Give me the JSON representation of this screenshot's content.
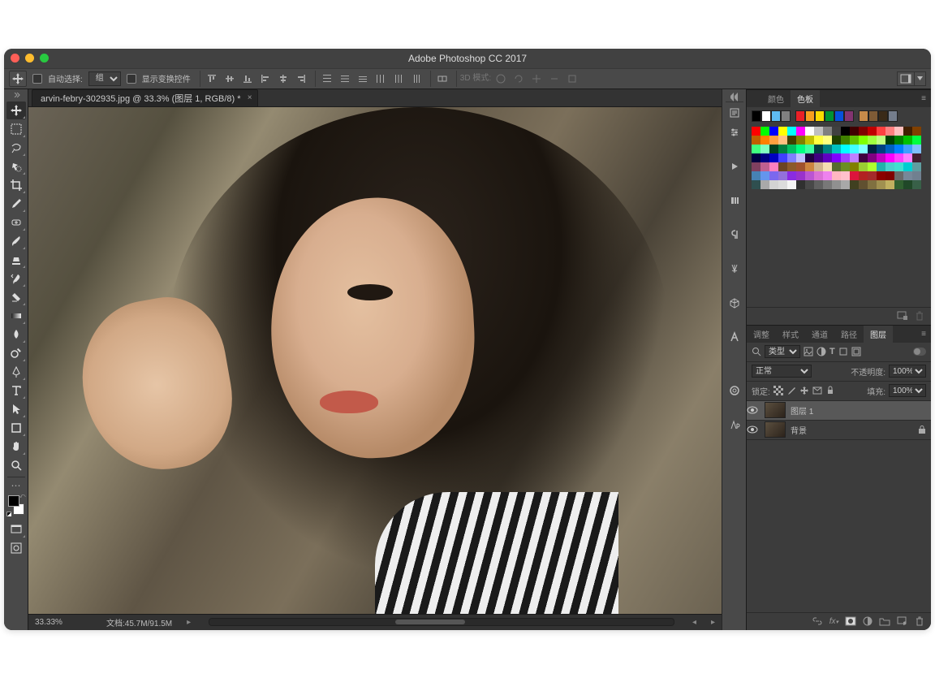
{
  "title": "Adobe Photoshop CC 2017",
  "options": {
    "auto_select": "自动选择:",
    "select_mode": "组",
    "show_transform": "显示变换控件",
    "mode_3d": "3D 模式:"
  },
  "doc_tab": "arvin-febry-302935.jpg @ 33.3% (图层 1, RGB/8) *",
  "status": {
    "zoom": "33.33%",
    "docinfo": "文档:45.7M/91.5M"
  },
  "panel_color_tabs": {
    "t0": "颜色",
    "t1": "色板"
  },
  "panel_layer_tabs": {
    "t0": "调整",
    "t1": "样式",
    "t2": "通道",
    "t3": "路径",
    "t4": "图层"
  },
  "layers": {
    "kind_label": "类型",
    "blend": "正常",
    "opacity_label": "不透明度:",
    "opacity_val": "100%",
    "lock_label": "锁定:",
    "fill_label": "填充:",
    "fill_val": "100%",
    "l0": "图层 1",
    "l1": "背景"
  },
  "palette_row": [
    "#000000",
    "#ffffff",
    "#5ebaf0",
    "#808080",
    "",
    "#ea2027",
    "#f79f1f",
    "#fcdc00",
    "#009432",
    "#0652dd",
    "#833471",
    "",
    "#c78b4a",
    "#7e5b36",
    "#3a2a18",
    "#747d8c"
  ],
  "swatches": [
    "#ff0000",
    "#00ff00",
    "#0000ff",
    "#ffff00",
    "#00ffff",
    "#ff00ff",
    "#ffffff",
    "#c0c0c0",
    "#808080",
    "#404040",
    "#000000",
    "#400000",
    "#800000",
    "#c00000",
    "#ff4040",
    "#ff8080",
    "#ffc0c0",
    "#402000",
    "#804000",
    "#c06000",
    "#ff8000",
    "#ffa040",
    "#ffc080",
    "#404000",
    "#808000",
    "#c0c000",
    "#ffff40",
    "#ffff80",
    "#204000",
    "#408000",
    "#60c000",
    "#80ff00",
    "#a0ff40",
    "#c0ff80",
    "#004000",
    "#008000",
    "#00c000",
    "#00ff40",
    "#40ff80",
    "#80ffc0",
    "#004020",
    "#008040",
    "#00c060",
    "#00ff80",
    "#40ffa0",
    "#004040",
    "#008080",
    "#00c0c0",
    "#00ffff",
    "#40ffff",
    "#80ffff",
    "#002040",
    "#004080",
    "#0060c0",
    "#0080ff",
    "#40a0ff",
    "#80c0ff",
    "#000040",
    "#000080",
    "#0000c0",
    "#4040ff",
    "#8080ff",
    "#c0c0ff",
    "#200040",
    "#400080",
    "#6000c0",
    "#8000ff",
    "#a040ff",
    "#c080ff",
    "#400040",
    "#800080",
    "#c000c0",
    "#ff00ff",
    "#ff40ff",
    "#ff80ff",
    "#402030",
    "#804060",
    "#c06090",
    "#ff80c0",
    "#6b4423",
    "#8b5a2b",
    "#a0522d",
    "#cd853f",
    "#d2b48c",
    "#f5deb3",
    "#556b2f",
    "#6b8e23",
    "#808000",
    "#9acd32",
    "#adff2f",
    "#20b2aa",
    "#48d1cc",
    "#40e0d0",
    "#00ced1",
    "#5f9ea0",
    "#4682b4",
    "#6495ed",
    "#7b68ee",
    "#9370db",
    "#8a2be2",
    "#9932cc",
    "#ba55d3",
    "#da70d6",
    "#ee82ee",
    "#ffb6c1",
    "#ffc0cb",
    "#dc143c",
    "#b22222",
    "#a52a2a",
    "#8b0000",
    "#800000",
    "#696969",
    "#778899",
    "#708090",
    "#2f4f4f",
    "#a9a9a9",
    "#d3d3d3",
    "#dcdcdc",
    "#f5f5f5",
    "#303030",
    "#484848",
    "#606060",
    "#787878",
    "#909090",
    "#a8a8a8",
    "#404020",
    "#605030",
    "#807040",
    "#a09050",
    "#c0b060",
    "#306030",
    "#204828",
    "#386048"
  ]
}
